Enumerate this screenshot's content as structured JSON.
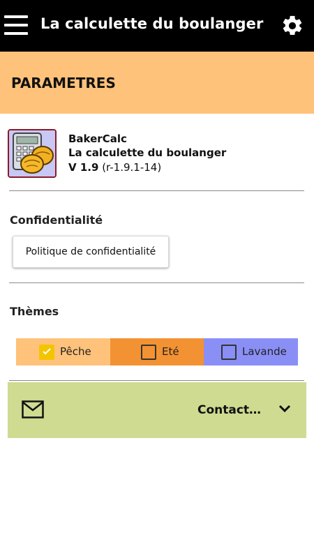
{
  "header": {
    "menu_icon": "hamburger-menu-icon",
    "title": "La calculette du boulanger",
    "settings_icon": "gear-icon"
  },
  "section": {
    "title": "PARAMETRES",
    "background": "#ffc27a"
  },
  "about": {
    "logo_icon": "calculator-bread-logo",
    "app_name": "BakerCalc",
    "subtitle": "La calculette du boulanger",
    "version": "V 1.9",
    "build": "(r-1.9.1-14)"
  },
  "privacy": {
    "label": "Confidentialité",
    "button_label": "Politique de confidentialité"
  },
  "themes": {
    "label": "Thèmes",
    "options": [
      {
        "label": "Pêche",
        "checked": true,
        "color": "#ffc27a"
      },
      {
        "label": "Eté",
        "checked": false,
        "color": "#f39232"
      },
      {
        "label": "Lavande",
        "checked": false,
        "color": "#8a8ff6"
      }
    ]
  },
  "contact": {
    "icon": "mail-icon",
    "label": "Contact…",
    "expand_icon": "chevron-down-icon",
    "background": "#cfdb91"
  }
}
